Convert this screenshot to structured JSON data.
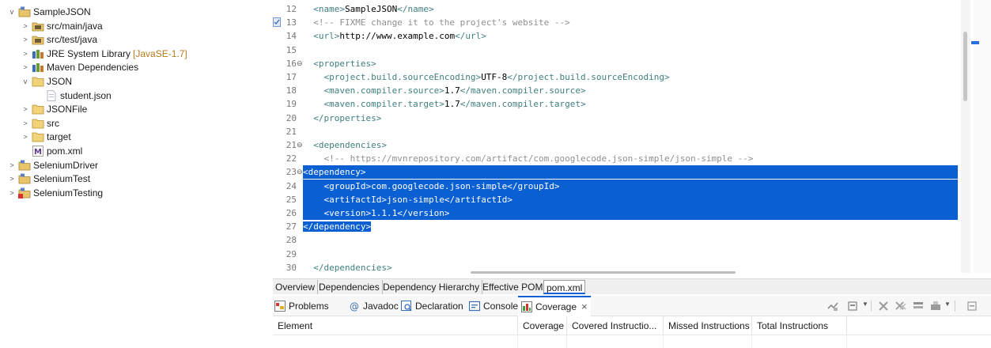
{
  "explorer": {
    "items": [
      {
        "label": "SampleJSON",
        "chevron": "v",
        "icon": "project-icon",
        "indent": 0
      },
      {
        "label": "src/main/java",
        "chevron": ">",
        "icon": "source-folder-icon",
        "indent": 1
      },
      {
        "label": "src/test/java",
        "chevron": ">",
        "icon": "source-folder-icon",
        "indent": 1
      },
      {
        "label": "JRE System Library",
        "decoration": "[JavaSE-1.7]",
        "chevron": ">",
        "icon": "library-icon",
        "indent": 1
      },
      {
        "label": "Maven Dependencies",
        "chevron": ">",
        "icon": "library-icon",
        "indent": 1
      },
      {
        "label": "JSON",
        "chevron": "v",
        "icon": "folder-icon",
        "indent": 1
      },
      {
        "label": "student.json",
        "chevron": "",
        "icon": "file-icon",
        "indent": 2
      },
      {
        "label": "JSONFile",
        "chevron": ">",
        "icon": "folder-icon",
        "indent": 1
      },
      {
        "label": "src",
        "chevron": ">",
        "icon": "folder-icon",
        "indent": 1
      },
      {
        "label": "target",
        "chevron": ">",
        "icon": "folder-icon",
        "indent": 1
      },
      {
        "label": "pom.xml",
        "chevron": "",
        "icon": "maven-file-icon",
        "indent": 1
      },
      {
        "label": "SeleniumDriver",
        "chevron": ">",
        "icon": "project-icon",
        "indent": 0
      },
      {
        "label": "SeleniumTest",
        "chevron": ">",
        "icon": "project-icon",
        "indent": 0
      },
      {
        "label": "SeleniumTesting",
        "chevron": ">",
        "icon": "project-error-icon",
        "indent": 0
      }
    ]
  },
  "editor": {
    "lines": [
      {
        "num": "12",
        "text": "  <name>SampleJSON</name>",
        "fold": "",
        "selected": false,
        "marker": ""
      },
      {
        "num": "13",
        "text": "  <!-- FIXME change it to the project's website -->",
        "fold": "",
        "selected": false,
        "marker": "task-marker-icon"
      },
      {
        "num": "14",
        "text": "  <url>http://www.example.com</url>",
        "fold": "",
        "selected": false,
        "marker": ""
      },
      {
        "num": "15",
        "text": "",
        "fold": "",
        "selected": false,
        "marker": ""
      },
      {
        "num": "16",
        "text": "  <properties>",
        "fold": "⊖",
        "selected": false,
        "marker": ""
      },
      {
        "num": "17",
        "text": "    <project.build.sourceEncoding>UTF-8</project.build.sourceEncoding>",
        "fold": "",
        "selected": false,
        "marker": ""
      },
      {
        "num": "18",
        "text": "    <maven.compiler.source>1.7</maven.compiler.source>",
        "fold": "",
        "selected": false,
        "marker": ""
      },
      {
        "num": "19",
        "text": "    <maven.compiler.target>1.7</maven.compiler.target>",
        "fold": "",
        "selected": false,
        "marker": ""
      },
      {
        "num": "20",
        "text": "  </properties>",
        "fold": "",
        "selected": false,
        "marker": ""
      },
      {
        "num": "21",
        "text": "",
        "fold": "",
        "selected": false,
        "marker": ""
      },
      {
        "num": "21",
        "text": "  <dependencies>",
        "fold": "⊖",
        "selected": false,
        "marker": ""
      },
      {
        "num": "22",
        "text": "    <!-- https://mvnrepository.com/artifact/com.googlecode.json-simple/json-simple -->",
        "fold": "",
        "selected": false,
        "marker": ""
      },
      {
        "num": "23",
        "text": "<dependency>",
        "fold": "⊖",
        "selected": true,
        "marker": ""
      },
      {
        "num": "24",
        "text": "    <groupId>com.googlecode.json-simple</groupId>",
        "fold": "",
        "selected": true,
        "marker": ""
      },
      {
        "num": "25",
        "text": "    <artifactId>json-simple</artifactId>",
        "fold": "",
        "selected": true,
        "marker": ""
      },
      {
        "num": "26",
        "text": "    <version>1.1.1</version>",
        "fold": "",
        "selected": true,
        "marker": ""
      },
      {
        "num": "27",
        "text": "</dependency>",
        "fold": "",
        "selected": "partial",
        "marker": ""
      },
      {
        "num": "28",
        "text": "",
        "fold": "",
        "selected": false,
        "marker": ""
      },
      {
        "num": "29",
        "text": "",
        "fold": "",
        "selected": false,
        "marker": ""
      },
      {
        "num": "30",
        "text": "  </dependencies>",
        "fold": "",
        "selected": false,
        "marker": ""
      }
    ]
  },
  "pom_tabs": [
    {
      "label": "Overview",
      "active": false
    },
    {
      "label": "Dependencies",
      "active": false
    },
    {
      "label": "Dependency Hierarchy",
      "active": false
    },
    {
      "label": "Effective POM",
      "active": false
    },
    {
      "label": "pom.xml",
      "active": true
    }
  ],
  "view_tabs": [
    {
      "label": "Problems",
      "icon": "problems-icon",
      "active": false
    },
    {
      "label": "Javadoc",
      "icon": "javadoc-icon",
      "active": false
    },
    {
      "label": "Declaration",
      "icon": "declaration-icon",
      "active": false
    },
    {
      "label": "Console",
      "icon": "console-icon",
      "active": false
    },
    {
      "label": "Coverage",
      "icon": "coverage-icon",
      "active": true
    }
  ],
  "view_close": "×",
  "coverage_columns": [
    "Element",
    "Coverage",
    "Covered Instructio...",
    "Missed Instructions",
    "Total Instructions"
  ],
  "colors": {
    "selection": "#0a5fd3",
    "tag": "#3f7f7f",
    "comment": "#8f8f8f",
    "accent": "#0a5fd3"
  }
}
